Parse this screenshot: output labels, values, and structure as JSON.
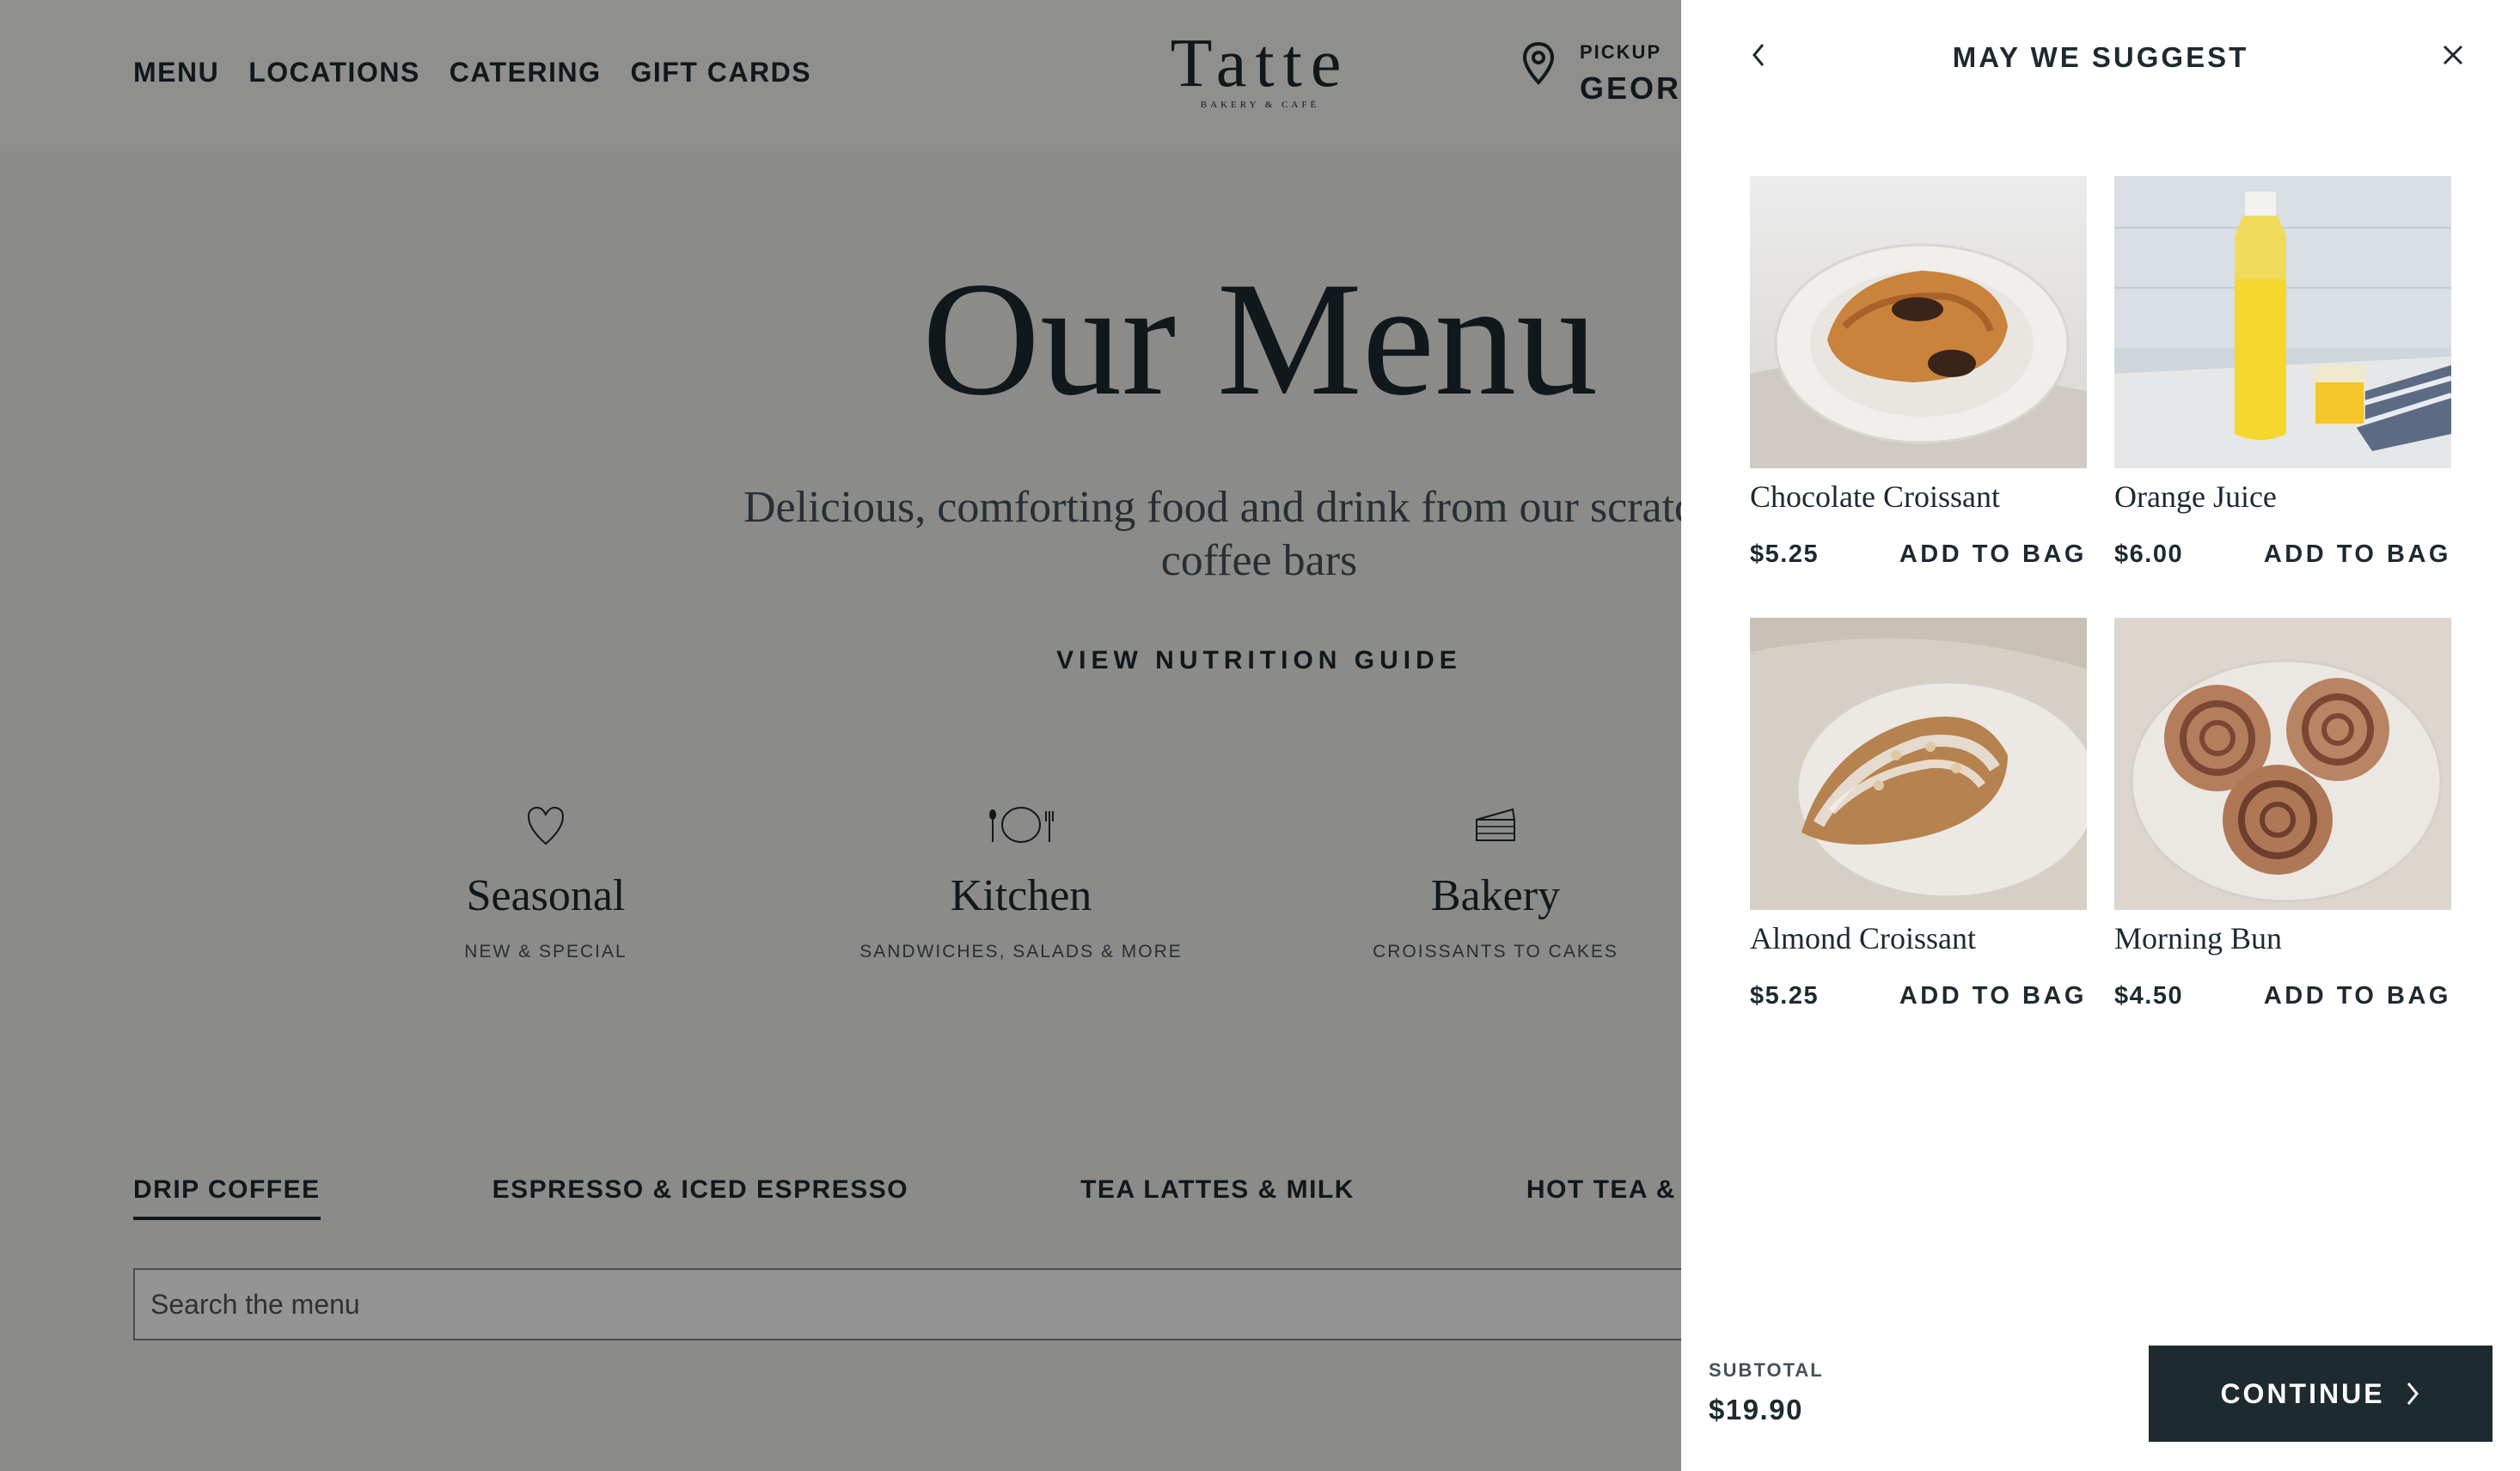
{
  "nav": {
    "items": [
      {
        "label": "MENU"
      },
      {
        "label": "LOCATIONS"
      },
      {
        "label": "CATERING"
      },
      {
        "label": "GIFT CARDS"
      }
    ]
  },
  "logo": {
    "main": "Tatte",
    "sub": "BAKERY & CAFÉ"
  },
  "pickup": {
    "label": "PICKUP",
    "value": "GEORG"
  },
  "hero": {
    "title": "Our Menu",
    "subtitle": "Delicious, comforting food and drink from our scratch kit",
    "subtitle_line2": "coffee bars",
    "nutrition_link": "VIEW NUTRITION GUIDE"
  },
  "categories": [
    {
      "title": "Seasonal",
      "sub": "NEW & SPECIAL",
      "icon": "heart-icon"
    },
    {
      "title": "Kitchen",
      "sub": "SANDWICHES, SALADS & MORE",
      "icon": "plate-cutlery-icon"
    },
    {
      "title": "Bakery",
      "sub": "CROISSANTS TO CAKES",
      "icon": "cake-slice-icon"
    }
  ],
  "tabs": [
    {
      "label": "DRIP COFFEE",
      "active": true
    },
    {
      "label": "ESPRESSO & ICED ESPRESSO"
    },
    {
      "label": "TEA LATTES & MILK"
    },
    {
      "label": "HOT TEA & ICED"
    }
  ],
  "search": {
    "placeholder": "Search the menu"
  },
  "drawer": {
    "title": "MAY WE SUGGEST",
    "add_label": "ADD TO BAG",
    "products": [
      {
        "name": "Chocolate Croissant",
        "price": "$5.25"
      },
      {
        "name": "Orange Juice",
        "price": "$6.00"
      },
      {
        "name": "Almond Croissant",
        "price": "$5.25"
      },
      {
        "name": "Morning Bun",
        "price": "$4.50"
      }
    ],
    "subtotal_label": "SUBTOTAL",
    "subtotal_value": "$19.90",
    "continue_label": "CONTINUE"
  },
  "colors": {
    "primary": "#1d2a30",
    "overlay": "rgba(0,0,0,0.42)",
    "drawer_bg": "#ffffff"
  }
}
